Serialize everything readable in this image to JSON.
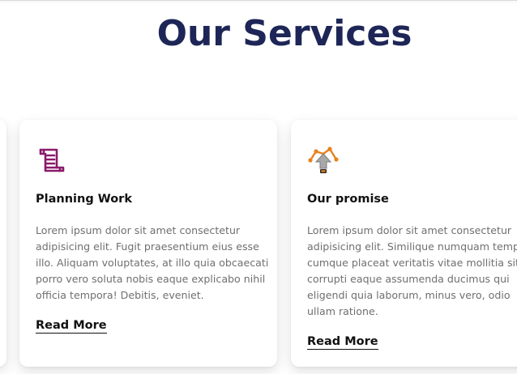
{
  "section": {
    "title": "Our Services"
  },
  "cards": [
    {
      "title": "Planning Work",
      "icon": "scroll-icon",
      "icon_color": "#8b1a6b",
      "lines": [
        "Lorem ipsum dolor sit amet consectetur",
        "adipisicing elit. Fugit praesentium eius esse",
        "illo. Aliquam voluptates, at illo quia obcaecati",
        "porro vero soluta nobis eaque explicabo nihil",
        "officia tempora! Debitis, eveniet."
      ],
      "link": "Read More"
    },
    {
      "title": "Our promise",
      "icon": "network-arrow-icon",
      "icon_color": "#e8821e",
      "lines": [
        "Lorem ipsum dolor sit amet consectetur",
        "adipisicing elit. Similique numquam tempo",
        "cumque placeat veritatis vitae mollitia sit",
        "corrupti eaque assumenda ducimus qui",
        "eligendi quia laborum, minus vero, odio",
        "ullam ratione."
      ],
      "link": "Read More"
    }
  ],
  "colors": {
    "title": "#1d2656",
    "body_text": "#6f6f6f",
    "heading_text": "#111111"
  }
}
